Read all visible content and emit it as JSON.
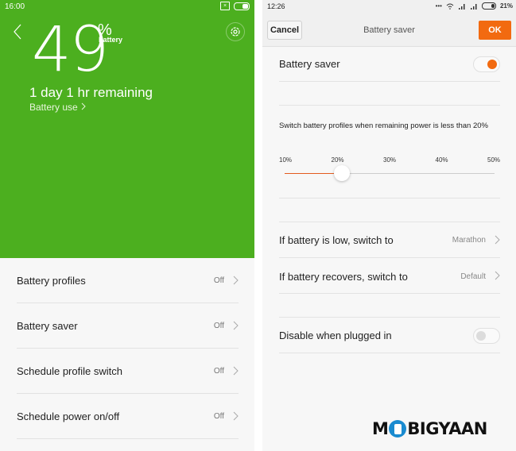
{
  "left": {
    "status_bar": {
      "time": "16:00",
      "sim_icon": "sim-x-icon",
      "battery_icon": "battery-icon"
    },
    "hero": {
      "percent_value": "49",
      "percent_sign": "%",
      "percent_label": "battery",
      "remaining": "1 day 1 hr remaining",
      "battery_use_link": "Battery use",
      "accent_color": "#4caf1f"
    },
    "items": [
      {
        "label": "Battery profiles",
        "value": "Off"
      },
      {
        "label": "Battery saver",
        "value": "Off"
      },
      {
        "label": "Schedule profile switch",
        "value": "Off"
      },
      {
        "label": "Schedule power on/off",
        "value": "Off"
      }
    ]
  },
  "right": {
    "status_bar": {
      "time": "12:26",
      "icons": [
        "more-dots-icon",
        "wifi-icon",
        "signal-icon",
        "signal-icon",
        "battery-icon"
      ],
      "battery_percent": "21%"
    },
    "toolbar": {
      "cancel_label": "Cancel",
      "title": "Battery saver",
      "ok_label": "OK",
      "ok_color": "#f26a10"
    },
    "battery_saver": {
      "label": "Battery saver",
      "enabled": true
    },
    "threshold": {
      "description": "Switch battery profiles when remaining power is less than 20%",
      "ticks": [
        "10%",
        "20%",
        "30%",
        "40%",
        "50%"
      ],
      "min": 10,
      "max": 50,
      "value": 20,
      "accent_color": "#e35b1d"
    },
    "low_switch": {
      "label": "If battery is low, switch to",
      "value": "Marathon"
    },
    "recover_switch": {
      "label": "If battery recovers, switch to",
      "value": "Default"
    },
    "disable_plugged": {
      "label": "Disable when plugged in",
      "enabled": false
    }
  },
  "watermark": {
    "text_left": "M",
    "text_right": "BIGYAAN"
  }
}
